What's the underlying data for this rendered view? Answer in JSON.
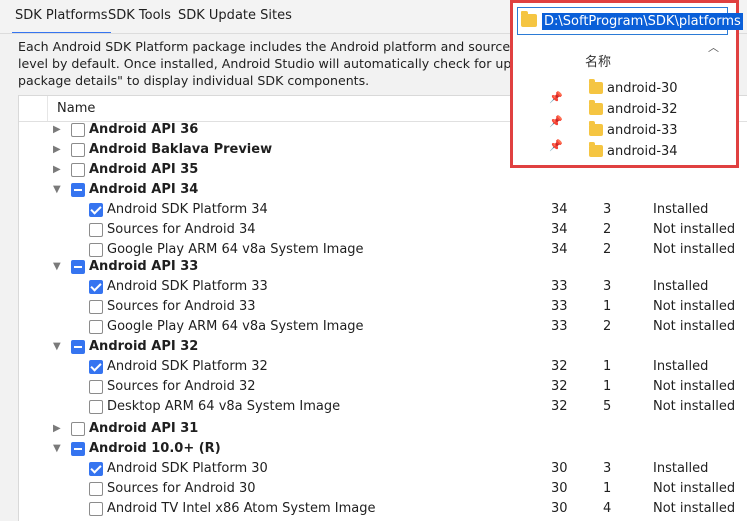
{
  "tabs": {
    "platforms": "SDK Platforms",
    "tools": "SDK Tools",
    "sites": "SDK Update Sites"
  },
  "description": {
    "line1": "Each Android SDK Platform package includes the Android platform and sources pert",
    "line2": "level by default. Once installed, Android Studio will automatically check for updates. C",
    "line3": "package details\" to display individual SDK components."
  },
  "table": {
    "col_name": "Name",
    "rows": [
      {
        "label": "Android API 36",
        "level": 0,
        "expander": "collapsed",
        "check": "unchecked",
        "api": "",
        "rev": "",
        "status": ""
      },
      {
        "label": "Android Baklava Preview",
        "level": 0,
        "expander": "collapsed",
        "check": "unchecked",
        "api": "",
        "rev": "",
        "status": ""
      },
      {
        "label": "Android API 35",
        "level": 0,
        "expander": "collapsed",
        "check": "unchecked",
        "api": "",
        "rev": "",
        "status": ""
      },
      {
        "label": "Android API 34",
        "level": 0,
        "expander": "expanded",
        "check": "partial",
        "api": "",
        "rev": "",
        "status": ""
      },
      {
        "label": "Android SDK Platform 34",
        "level": 1,
        "expander": "",
        "check": "checked",
        "api": "34",
        "rev": "3",
        "status": "Installed"
      },
      {
        "label": "Sources for Android 34",
        "level": 1,
        "expander": "",
        "check": "unchecked",
        "api": "34",
        "rev": "2",
        "status": "Not installed"
      },
      {
        "label": "Google Play ARM 64 v8a System Image",
        "level": 1,
        "expander": "",
        "check": "unchecked",
        "api": "34",
        "rev": "2",
        "status": "Not installed"
      },
      {
        "label": "Android API 33",
        "level": 0,
        "expander": "expanded",
        "check": "partial",
        "api": "",
        "rev": "",
        "status": ""
      },
      {
        "label": "Android SDK Platform 33",
        "level": 1,
        "expander": "",
        "check": "checked",
        "api": "33",
        "rev": "3",
        "status": "Installed"
      },
      {
        "label": "Sources for Android 33",
        "level": 1,
        "expander": "",
        "check": "unchecked",
        "api": "33",
        "rev": "1",
        "status": "Not installed"
      },
      {
        "label": "Google Play ARM 64 v8a System Image",
        "level": 1,
        "expander": "",
        "check": "unchecked",
        "api": "33",
        "rev": "2",
        "status": "Not installed"
      },
      {
        "label": "Android API 32",
        "level": 0,
        "expander": "expanded",
        "check": "partial",
        "api": "",
        "rev": "",
        "status": ""
      },
      {
        "label": "Android SDK Platform 32",
        "level": 1,
        "expander": "",
        "check": "checked",
        "api": "32",
        "rev": "1",
        "status": "Installed"
      },
      {
        "label": "Sources for Android 32",
        "level": 1,
        "expander": "",
        "check": "unchecked",
        "api": "32",
        "rev": "1",
        "status": "Not installed"
      },
      {
        "label": "Desktop ARM 64 v8a System Image",
        "level": 1,
        "expander": "",
        "check": "unchecked",
        "api": "32",
        "rev": "5",
        "status": "Not installed"
      },
      {
        "label": "Android API 31",
        "level": 0,
        "expander": "collapsed",
        "check": "unchecked",
        "api": "",
        "rev": "",
        "status": ""
      },
      {
        "label": "Android 10.0+ (R)",
        "level": 0,
        "expander": "expanded",
        "check": "partial",
        "api": "",
        "rev": "",
        "status": ""
      },
      {
        "label": "Android SDK Platform 30",
        "level": 1,
        "expander": "",
        "check": "checked",
        "api": "30",
        "rev": "3",
        "status": "Installed"
      },
      {
        "label": "Sources for Android 30",
        "level": 1,
        "expander": "",
        "check": "unchecked",
        "api": "30",
        "rev": "1",
        "status": "Not installed"
      },
      {
        "label": "Android TV Intel x86 Atom System Image",
        "level": 1,
        "expander": "",
        "check": "unchecked",
        "api": "30",
        "rev": "4",
        "status": "Not installed"
      }
    ]
  },
  "explorer": {
    "path": "D:\\SoftProgram\\SDK\\platforms",
    "column_header": "名称",
    "folders": [
      "android-30",
      "android-32",
      "android-33",
      "android-34"
    ],
    "folder_icon": "folder-icon",
    "pin_icon": "pin-icon"
  },
  "colors": {
    "accent": "#3574f0",
    "highlight_border": "#e04040",
    "path_selection": "#0a5fd8",
    "folder": "#f5c542"
  }
}
